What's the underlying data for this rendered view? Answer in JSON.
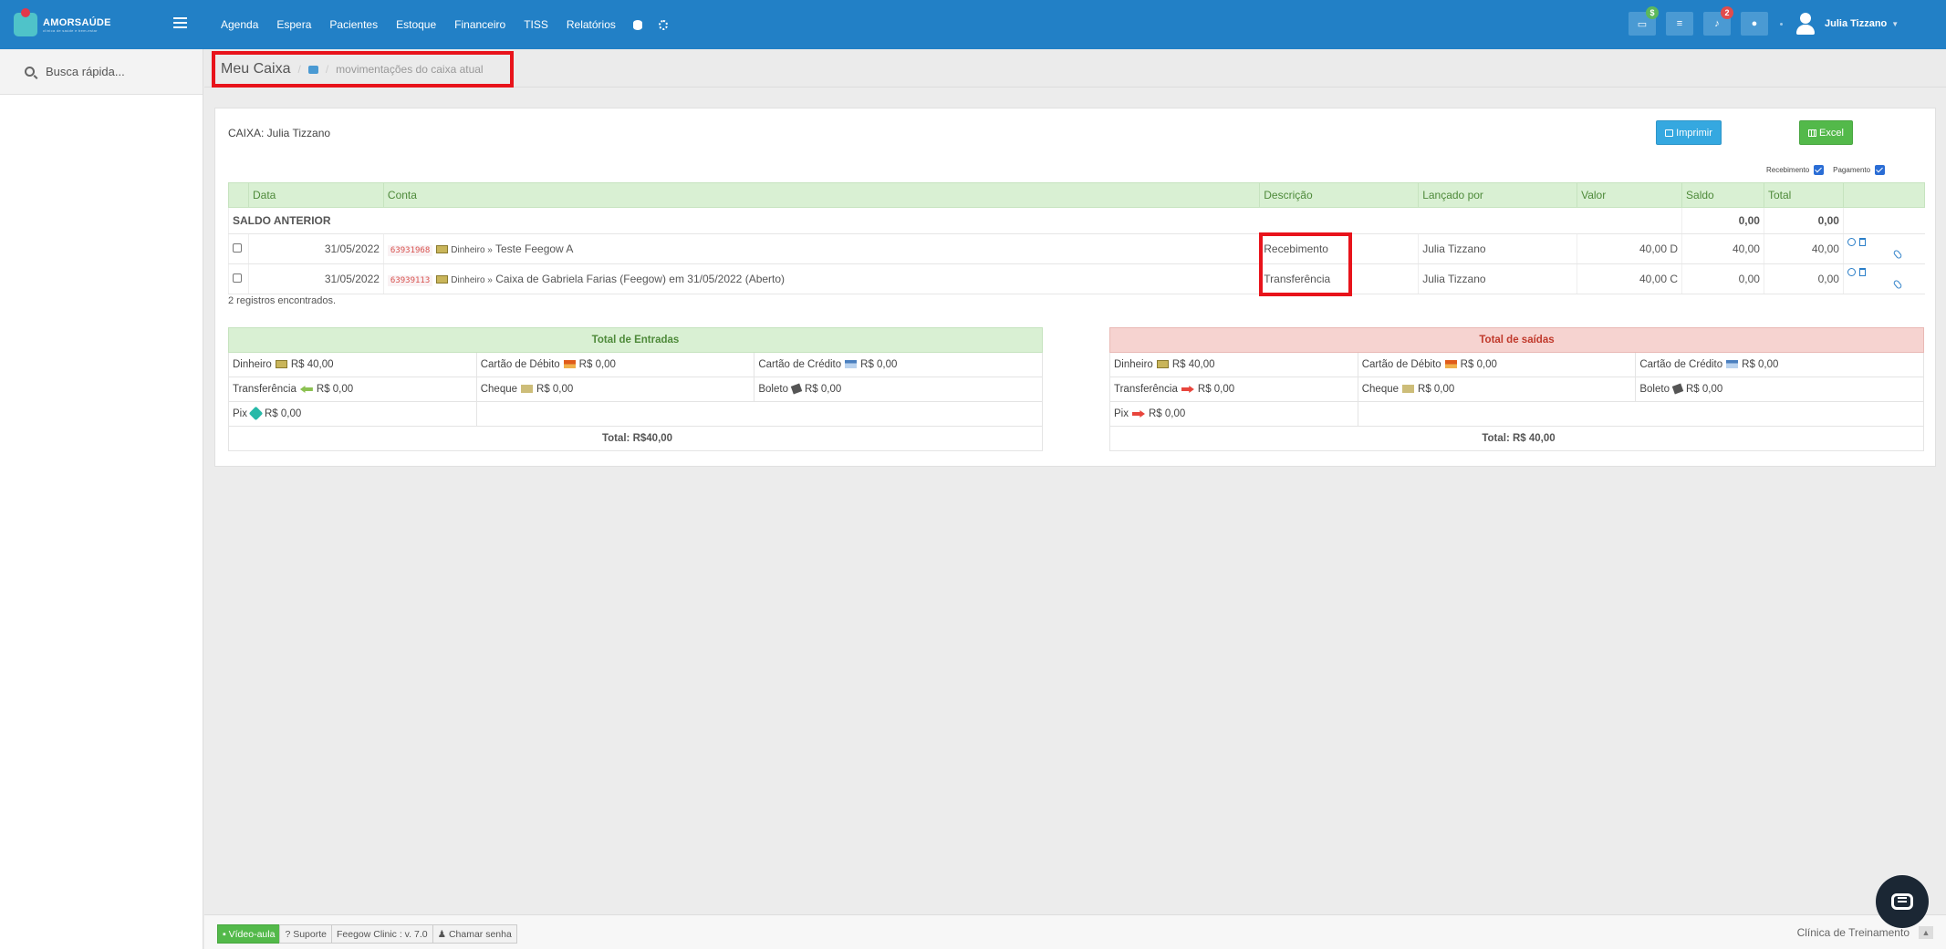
{
  "app": {
    "logo_text": "AMORSAÚDE",
    "logo_sub": "clínica de saúde e bem-estar"
  },
  "topnav": {
    "items": [
      "Agenda",
      "Espera",
      "Pacientes",
      "Estoque",
      "Financeiro",
      "TISS",
      "Relatórios"
    ],
    "icons": [
      "database-icon",
      "gear-icon"
    ]
  },
  "topright": {
    "caixa_badge": "$",
    "notif_badge": "2",
    "user_name": "Julia Tizzano"
  },
  "sidebar": {
    "search_placeholder": "Busca rápida..."
  },
  "breadcrumb": {
    "title": "Meu Caixa",
    "subtitle": "movimentações do caixa atual"
  },
  "panel": {
    "caixa_label": "CAIXA: Julia Tizzano",
    "print_label": "Imprimir",
    "excel_label": "Excel",
    "filter_recebimento": "Recebimento",
    "filter_pagamento": "Pagamento"
  },
  "table": {
    "headers": [
      "",
      "Data",
      "Conta",
      "Descrição",
      "Lançado por",
      "Valor",
      "Saldo",
      "Total",
      ""
    ],
    "saldo_label": "SALDO ANTERIOR",
    "saldo_saldo": "0,00",
    "saldo_total": "0,00",
    "rows": [
      {
        "date": "31/05/2022",
        "code": "63931968",
        "method": "Dinheiro »",
        "account": "Teste Feegow A",
        "desc": "Recebimento",
        "by": "Julia Tizzano",
        "value": "40,00 D",
        "saldo": "40,00",
        "total": "40,00"
      },
      {
        "date": "31/05/2022",
        "code": "63939113",
        "method": "Dinheiro »",
        "account": "Caixa de Gabriela Farias (Feegow) em 31/05/2022 (Aberto)",
        "desc": "Transferência",
        "by": "Julia Tizzano",
        "value": "40,00 C",
        "saldo": "0,00",
        "total": "0,00"
      }
    ],
    "records": "2 registros encontrados."
  },
  "entradas": {
    "title": "Total de Entradas",
    "dinheiro": "Dinheiro",
    "dinheiro_v": "R$ 40,00",
    "debito": "Cartão de Débito",
    "debito_v": "R$ 0,00",
    "credito": "Cartão de Crédito",
    "credito_v": "R$ 0,00",
    "transf": "Transferência",
    "transf_v": "R$ 0,00",
    "cheque": "Cheque",
    "cheque_v": "R$ 0,00",
    "boleto": "Boleto",
    "boleto_v": "R$ 0,00",
    "pix": "Pix",
    "pix_v": "R$ 0,00",
    "total": "Total: R$40,00"
  },
  "saidas": {
    "title": "Total de saídas",
    "dinheiro": "Dinheiro",
    "dinheiro_v": "R$ 40,00",
    "debito": "Cartão de Débito",
    "debito_v": "R$ 0,00",
    "credito": "Cartão de Crédito",
    "credito_v": "R$ 0,00",
    "transf": "Transferência",
    "transf_v": "R$ 0,00",
    "cheque": "Cheque",
    "cheque_v": "R$ 0,00",
    "boleto": "Boleto",
    "boleto_v": "R$ 0,00",
    "pix": "Pix",
    "pix_v": "R$ 0,00",
    "total": "Total: R$ 40,00"
  },
  "footer": {
    "video": "Vídeo-aula",
    "suporte": "Suporte",
    "version": "Feegow Clinic : v. 7.0",
    "senha": "Chamar senha",
    "clinic": "Clínica de Treinamento"
  },
  "colors": {
    "topbar": "#2280c6",
    "highlight": "#e8131b",
    "green_header": "#d9f0d3",
    "red_header": "#f6d3d0"
  }
}
